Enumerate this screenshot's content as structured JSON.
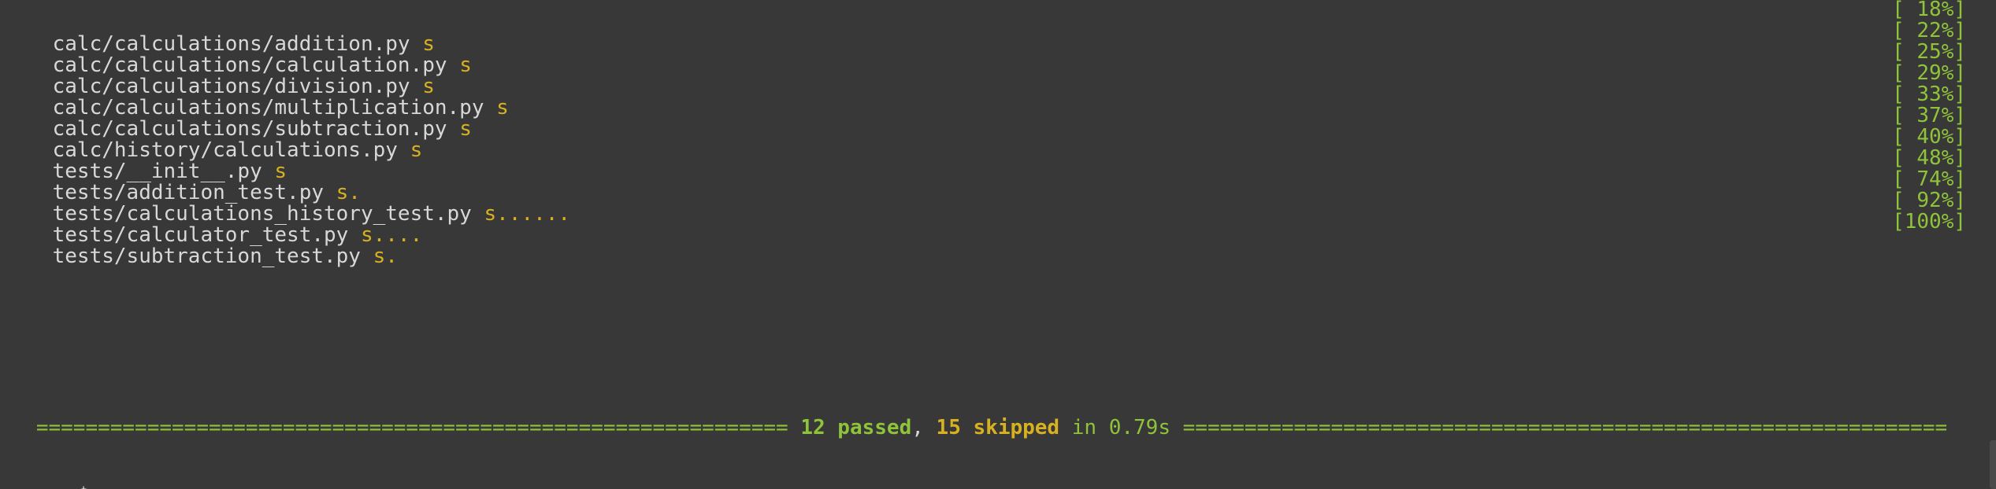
{
  "results": [
    {
      "path": "calc/calculations/addition.py",
      "marks": "s",
      "progress": "[ 18%]"
    },
    {
      "path": "calc/calculations/calculation.py",
      "marks": "s",
      "progress": "[ 22%]"
    },
    {
      "path": "calc/calculations/division.py",
      "marks": "s",
      "progress": "[ 25%]"
    },
    {
      "path": "calc/calculations/multiplication.py",
      "marks": "s",
      "progress": "[ 29%]"
    },
    {
      "path": "calc/calculations/subtraction.py",
      "marks": "s",
      "progress": "[ 33%]"
    },
    {
      "path": "calc/history/calculations.py",
      "marks": "s",
      "progress": "[ 37%]"
    },
    {
      "path": "tests/__init__.py",
      "marks": "s",
      "progress": "[ 40%]"
    },
    {
      "path": "tests/addition_test.py",
      "marks": "s.",
      "progress": "[ 48%]"
    },
    {
      "path": "tests/calculations_history_test.py",
      "marks": "s......",
      "progress": "[ 74%]"
    },
    {
      "path": "tests/calculator_test.py",
      "marks": "s....",
      "progress": "[ 92%]"
    },
    {
      "path": "tests/subtraction_test.py",
      "marks": "s.",
      "progress": "[100%]"
    }
  ],
  "summary": {
    "left_rule": "=============================================================",
    "passed": "12 passed",
    "separator": ",",
    "skipped": "15 skipped",
    "timing": "in 0.79s",
    "right_rule": "=============================================================="
  },
  "prompt": "~ $",
  "colors": {
    "background": "#383838",
    "text": "#d8d8d8",
    "pass": "#8fc33a",
    "skip": "#d7b11f"
  }
}
